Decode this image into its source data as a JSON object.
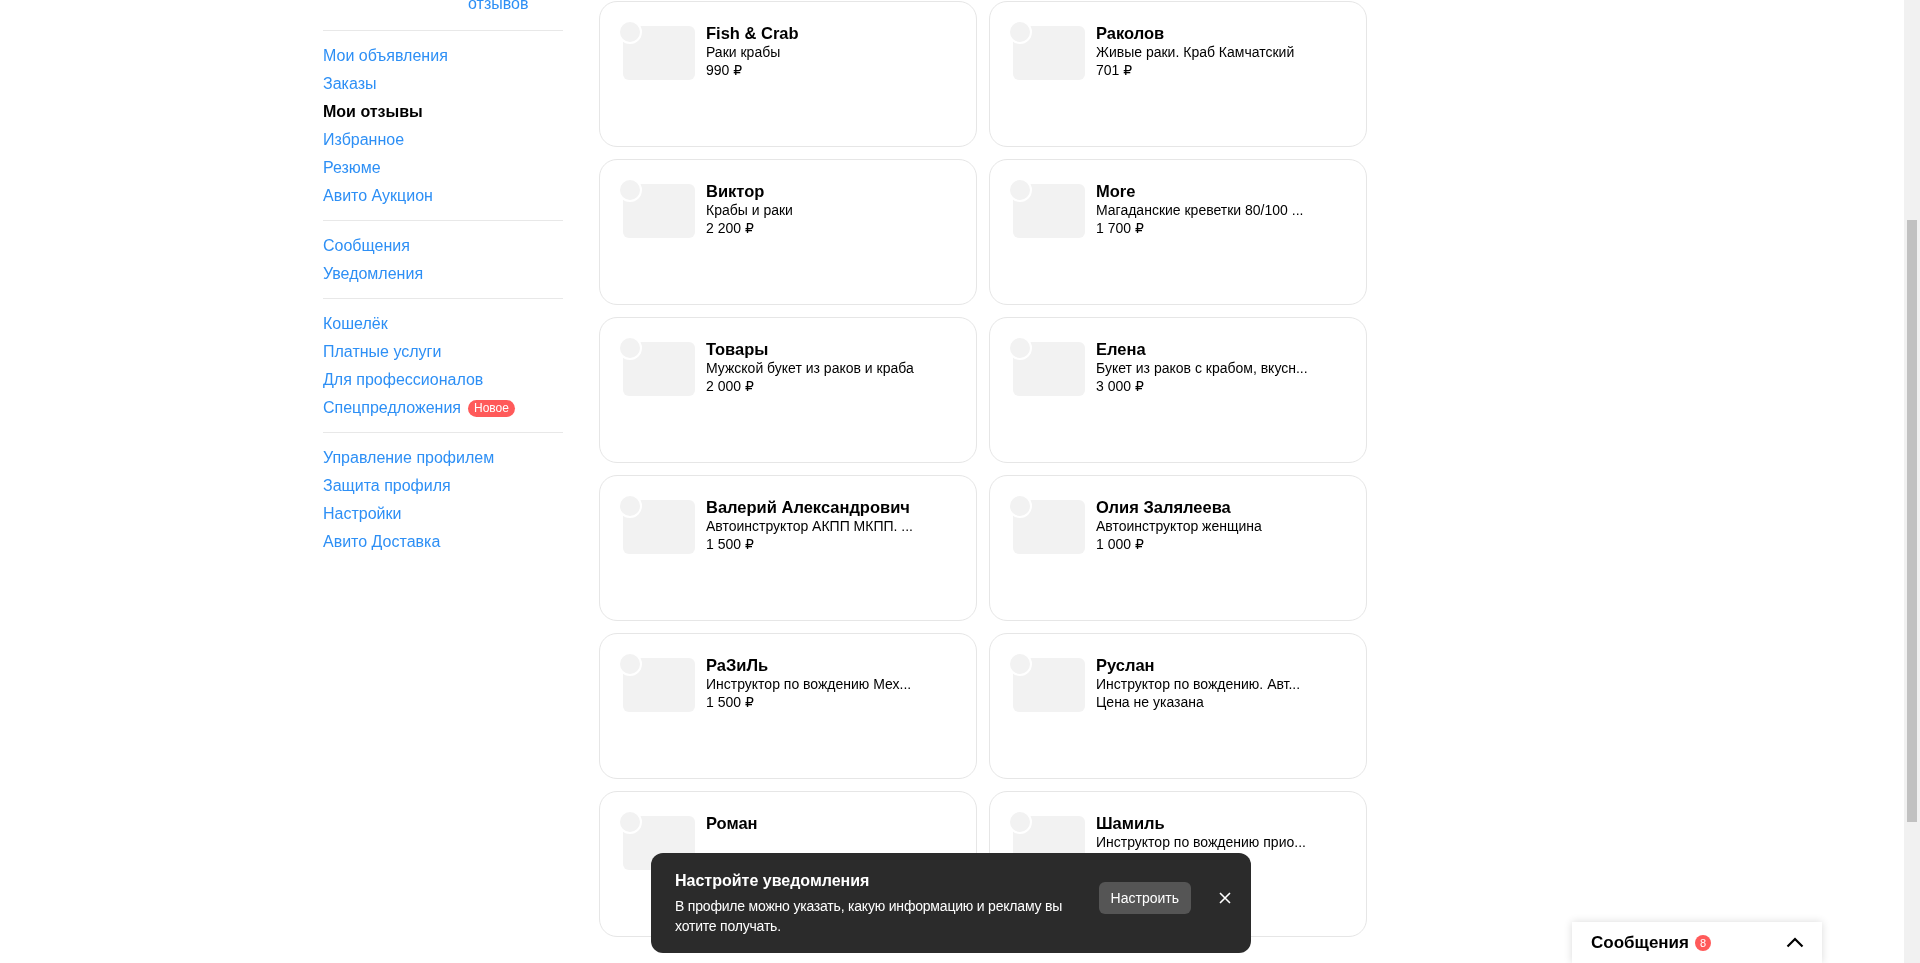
{
  "sidebar": {
    "reviews_link": "отзывов",
    "groups": [
      [
        {
          "label": "Мои объявления",
          "selected": false
        },
        {
          "label": "Заказы",
          "selected": false
        },
        {
          "label": "Мои отзывы",
          "selected": true
        },
        {
          "label": "Избранное",
          "selected": false
        },
        {
          "label": "Резюме",
          "selected": false
        },
        {
          "label": "Авито Аукцион",
          "selected": false
        }
      ],
      [
        {
          "label": "Сообщения",
          "selected": false
        },
        {
          "label": "Уведомления",
          "selected": false
        }
      ],
      [
        {
          "label": "Кошелёк",
          "selected": false
        },
        {
          "label": "Платные услуги",
          "selected": false
        },
        {
          "label": "Для профессионалов",
          "selected": false
        },
        {
          "label": "Спецпредложения",
          "selected": false,
          "badge": "Новое"
        }
      ],
      [
        {
          "label": "Управление профилем",
          "selected": false
        },
        {
          "label": "Защита профиля",
          "selected": false
        },
        {
          "label": "Настройки",
          "selected": false
        },
        {
          "label": "Авито Доставка",
          "selected": false
        }
      ]
    ]
  },
  "cards": [
    {
      "checked": false,
      "title": "Fish & Crab",
      "subtitle": "Раки крабы",
      "price": "990 ₽"
    },
    {
      "checked": false,
      "title": "Раколов",
      "subtitle": "Живые раки. Краб Камчатский",
      "price": "701 ₽"
    },
    {
      "checked": false,
      "title": "Виктор",
      "subtitle": "Крабы и раки",
      "price": "2 200 ₽"
    },
    {
      "checked": false,
      "title": "More",
      "subtitle": "Магаданские креветки 80/100 ...",
      "price": "1 700 ₽"
    },
    {
      "checked": false,
      "title": "Товары",
      "subtitle": "Мужской букет из раков и краба",
      "price": "2 000 ₽"
    },
    {
      "checked": false,
      "title": "Елена",
      "subtitle": "Букет из раков с крабом, вкусн...",
      "price": "3 000 ₽"
    },
    {
      "checked": false,
      "title": "Валерий Александрович",
      "subtitle": "Автоинструктор АКПП МКПП. ...",
      "price": "1 500 ₽"
    },
    {
      "checked": false,
      "title": "Олия Залялеева",
      "subtitle": "Автоинструктор женщина",
      "price": "1 000 ₽"
    },
    {
      "checked": false,
      "title": "РаЗиЛь",
      "subtitle": "Инструктор по вождению Мех...",
      "price": "1 500 ₽"
    },
    {
      "checked": false,
      "title": "Руслан",
      "subtitle": "Инструктор по вождению. Авт...",
      "price": "Цена не указана"
    },
    {
      "checked": false,
      "title": "Роман"
    },
    {
      "checked": false,
      "title": "Шамиль",
      "subtitle": "Инструктор по вождению прио..."
    }
  ],
  "toast": {
    "title": "Настройте уведомления",
    "text": "В профиле можно указать, какую информацию и рекламу вы хотите получать.",
    "button": "Настроить"
  },
  "messages_bar": {
    "label": "Сообщения",
    "count": "8"
  }
}
